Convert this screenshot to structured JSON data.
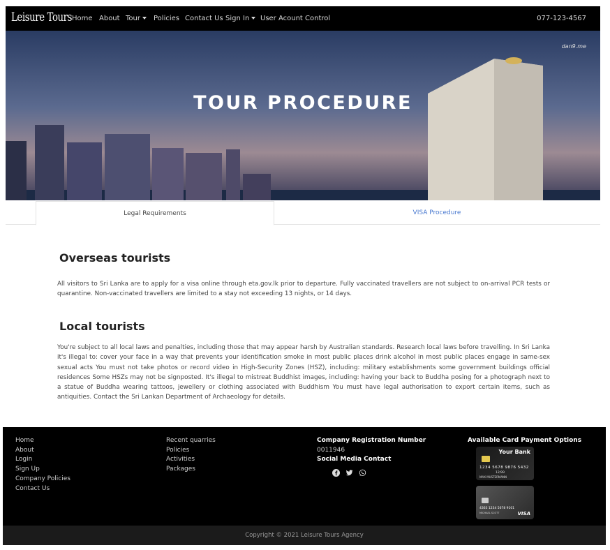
{
  "navbar": {
    "brand": "Leisure Tours",
    "items": [
      {
        "label": "Home"
      },
      {
        "label": "About"
      },
      {
        "label": "Tour"
      },
      {
        "label": "Policies"
      },
      {
        "label": "Contact Us"
      },
      {
        "label": "Sign In"
      },
      {
        "label": "User Acount Control"
      }
    ],
    "phone": "077-123-4567"
  },
  "hero": {
    "title": "TOUR PROCEDURE",
    "watermark": "dan9.me"
  },
  "tabs": [
    {
      "label": "Legal Requirements",
      "active": true
    },
    {
      "label": "VISA Procedure",
      "active": false
    }
  ],
  "sections": [
    {
      "title": "Overseas tourists",
      "body": "All visitors to Sri Lanka are to apply for a visa online through eta.gov.lk prior to departure. Fully vaccinated travellers are not subject to on-arrival PCR tests or quarantine. Non-vaccinated travellers are limited to a stay not exceeding 13 nights, or 14 days."
    },
    {
      "title": "Local tourists",
      "body": "You're subject to all local laws and penalties, including those that may appear harsh by Australian standards. Research local laws before travelling. In Sri Lanka it's illegal to: cover your face in a way that prevents your identification smoke in most public places drink alcohol in most public places engage in same-sex sexual acts You must not take photos or record video in High-Security Zones (HSZ), including: military establishments some government buildings official residences Some HSZs may not be signposted. It's illegal to mistreat Buddhist images, including: having your back to Buddha posing for a photograph next to a statue of Buddha wearing tattoos, jewellery or clothing associated with Buddhism You must have legal authorisation to export certain items, such as antiquities. Contact the Sri Lankan Department of Archaeology for details."
    }
  ],
  "footer": {
    "col1": [
      "Home",
      "About",
      "Login",
      "Sign Up",
      "Company Policies",
      "Contact Us"
    ],
    "col2": [
      "Recent quarries",
      "Policies",
      "Activities",
      "Packages"
    ],
    "reg_heading": "Company Registration Number",
    "reg_number": "0011946",
    "social_heading": "Social Media Contact",
    "social_icons": [
      "facebook-icon",
      "twitter-icon",
      "whatsapp-icon"
    ],
    "payment_heading": "Available Card Payment Options",
    "card1": {
      "bank": "Your Bank",
      "number": "1234 5678 9876 5432",
      "valid": "12/99",
      "name": "MAX MUSTERMANN"
    },
    "card2": {
      "number": "4363 1234 5678 9101",
      "name": "MICHAEL SCOTT",
      "brand": "VISA"
    }
  },
  "copyright": "Copyright © 2021 Leisure Tours Agency"
}
